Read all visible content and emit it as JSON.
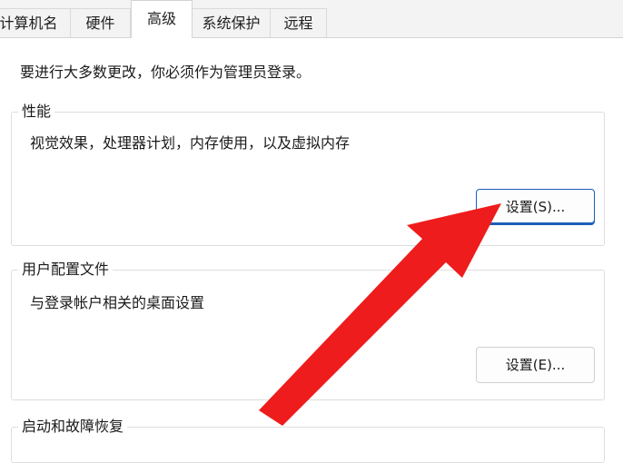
{
  "tabs": [
    {
      "label": "计算机名",
      "active": false
    },
    {
      "label": "硬件",
      "active": false
    },
    {
      "label": "高级",
      "active": true
    },
    {
      "label": "系统保护",
      "active": false
    },
    {
      "label": "远程",
      "active": false
    }
  ],
  "admin_note": "要进行大多数更改，你必须作为管理员登录。",
  "performance": {
    "title": "性能",
    "description": "视觉效果，处理器计划，内存使用，以及虚拟内存",
    "settings_label": "设置(S)..."
  },
  "user_profiles": {
    "title": "用户配置文件",
    "description": "与登录帐户相关的桌面设置",
    "settings_label": "设置(E)..."
  },
  "startup_recovery": {
    "title": "启动和故障恢复"
  },
  "colors": {
    "arrow": "#ee1c1c",
    "focus_border": "#1c5fb8"
  },
  "icons": {
    "annotation": "red-arrow-pointer"
  }
}
